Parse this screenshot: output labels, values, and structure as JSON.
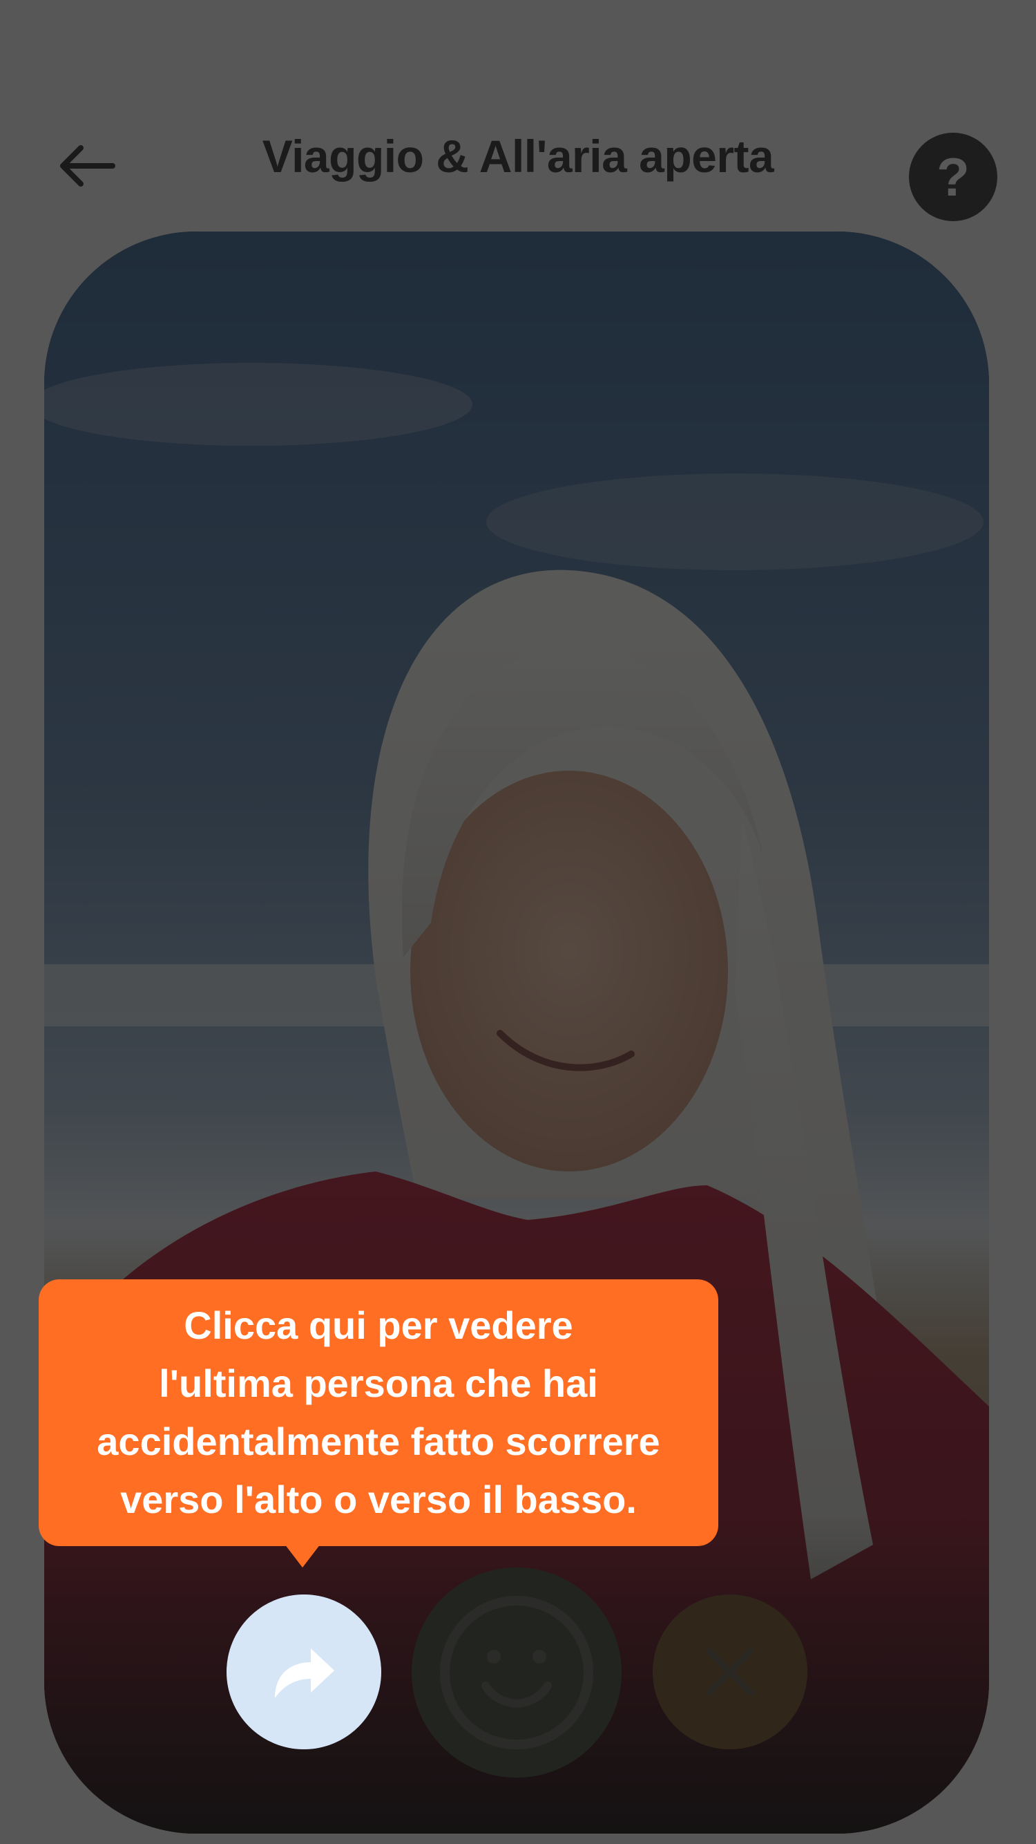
{
  "header": {
    "title": "Viaggio & All'aria aperta",
    "back_icon": "arrow-left-icon",
    "help_label": "?"
  },
  "card": {
    "photo": "profile-photo"
  },
  "tooltip": {
    "text": "Clicca qui per vedere\nl'ultima persona che hai\naccidentalmente fatto scorrere\nverso l'alto o verso il basso."
  },
  "actions": {
    "rewind_icon": "rewind-share-icon",
    "like_icon": "smiley-icon",
    "nope_icon": "close-icon"
  },
  "colors": {
    "tooltip": "#ff6e22",
    "rewind_bg": "#d6e6f7",
    "like_bg": "#3b4431",
    "nope_bg": "#6d4b1e"
  }
}
